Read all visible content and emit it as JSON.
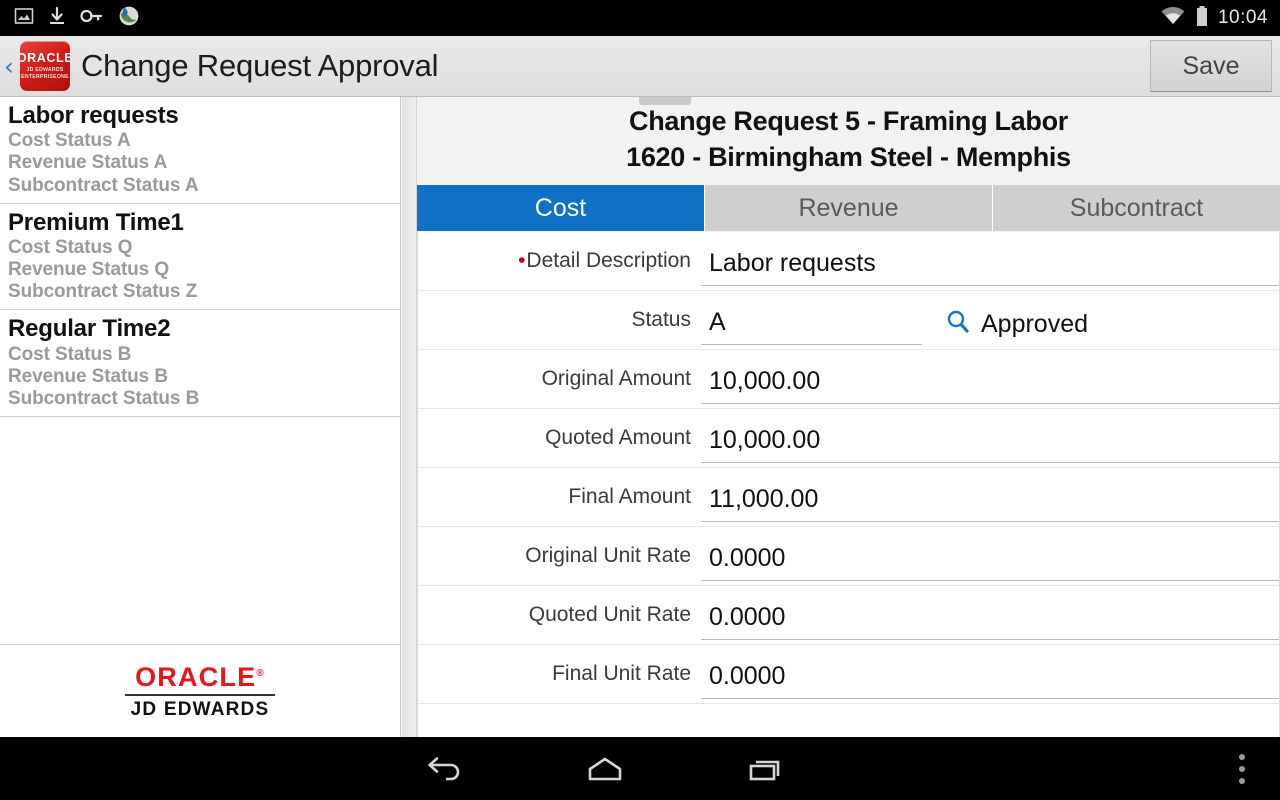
{
  "statusbar": {
    "time": "10:04",
    "left_icons": [
      "screenshot-icon",
      "download-icon",
      "vpn-key-icon",
      "browser-globe-icon"
    ],
    "right_icons": [
      "wifi-icon",
      "battery-icon"
    ]
  },
  "appbar": {
    "back_label": "‹",
    "logo": {
      "line1": "ORACLE",
      "line2": "JD EDWARDS",
      "line3": "ENTERPRISEONE"
    },
    "title": "Change Request Approval",
    "save_label": "Save"
  },
  "sidebar": {
    "items": [
      {
        "title": "Labor requests",
        "cost_status": "Cost Status A",
        "revenue_status": "Revenue Status A",
        "subcontract_status": "Subcontract Status A"
      },
      {
        "title": "Premium Time1",
        "cost_status": "Cost Status Q",
        "revenue_status": "Revenue Status Q",
        "subcontract_status": "Subcontract Status Z"
      },
      {
        "title": "Regular Time2",
        "cost_status": "Cost Status B",
        "revenue_status": "Revenue Status B",
        "subcontract_status": "Subcontract Status B"
      }
    ],
    "footer": {
      "oracle": "ORACLE",
      "trademark": "®",
      "product": "JD EDWARDS"
    }
  },
  "detail": {
    "title_line1": "Change Request 5 - Framing Labor",
    "title_line2": "1620 - Birmingham Steel - Memphis",
    "tabs": [
      {
        "label": "Cost",
        "active": true
      },
      {
        "label": "Revenue",
        "active": false
      },
      {
        "label": "Subcontract",
        "active": false
      }
    ],
    "fields": [
      {
        "label": "Detail Description",
        "value": "Labor requests",
        "required": true
      },
      {
        "label": "Status",
        "value": "A",
        "lookup_text": "Approved",
        "lookup_icon": "search-icon"
      },
      {
        "label": "Original Amount",
        "value": "10,000.00"
      },
      {
        "label": "Quoted Amount",
        "value": "10,000.00"
      },
      {
        "label": "Final Amount",
        "value": "11,000.00"
      },
      {
        "label": "Original Unit Rate",
        "value": "0.0000"
      },
      {
        "label": "Quoted Unit Rate",
        "value": "0.0000"
      },
      {
        "label": "Final Unit Rate",
        "value": "0.0000"
      }
    ]
  },
  "navbar": {
    "back": "back-icon",
    "home": "home-icon",
    "recents": "recents-icon",
    "overflow": "overflow-menu-icon"
  },
  "colors": {
    "accent_blue": "#0f72c6",
    "oracle_red": "#e8161b",
    "required_red": "#d0021b"
  }
}
